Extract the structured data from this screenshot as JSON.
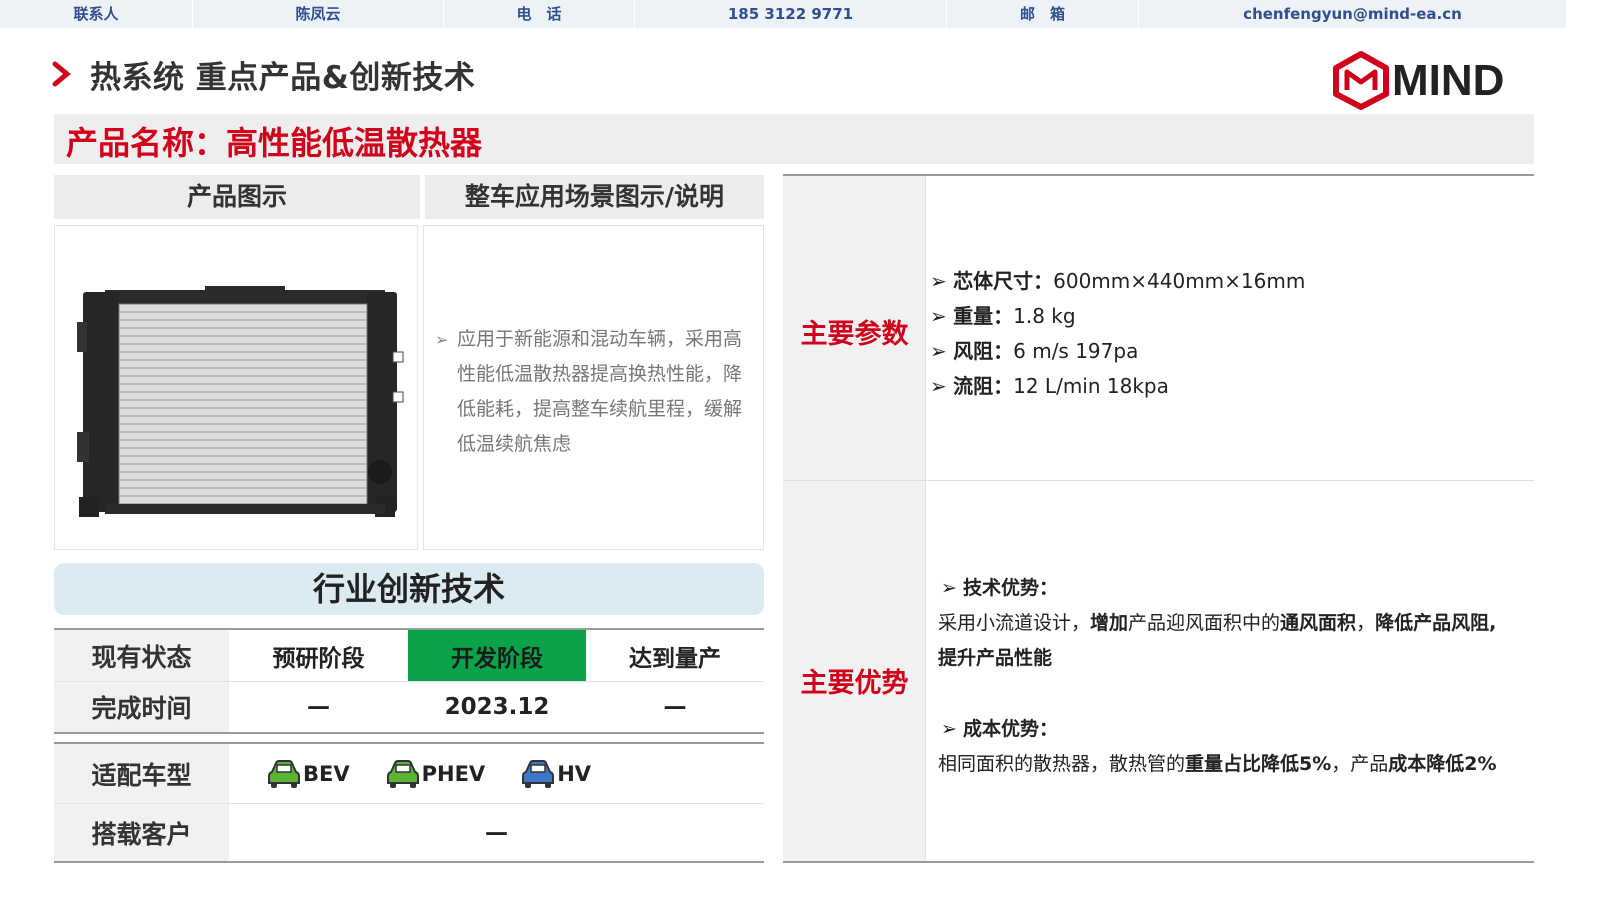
{
  "contact": {
    "label1": "联系人",
    "name": "陈凤云",
    "label2": "电　话",
    "phone": "185 3122 9771",
    "label3": "邮　箱",
    "email": "chenfengyun@mind-ea.cn"
  },
  "header": {
    "title": "热系统 重点产品&创新技术",
    "logo_text": "MIND"
  },
  "product": {
    "name": "产品名称：高性能低温散热器"
  },
  "sections": {
    "product_image": "产品图示",
    "scenario": "整车应用场景图示/说明"
  },
  "scenario_desc": "应用于新能源和混动车辆，采用高性能低温散热器提高换热性能，降低能耗，提高整车续航里程，缓解低温续航焦虑",
  "innovation": {
    "title": "行业创新技术",
    "status_label": "现有状态",
    "stages": [
      "预研阶段",
      "开发阶段",
      "达到量产"
    ],
    "time_label": "完成时间",
    "times": [
      "—",
      "2023.12",
      "—"
    ],
    "vehicle_label": "适配车型",
    "vehicles": [
      {
        "name": "BEV",
        "color": "#5bb336"
      },
      {
        "name": "PHEV",
        "color": "#5bb336"
      },
      {
        "name": "HV",
        "color": "#3d78c8"
      }
    ],
    "customer_label": "搭载客户",
    "customer": "—",
    "active_color": "#0aa34a"
  },
  "main_params": {
    "label": "主要参数",
    "items": [
      {
        "k": "芯体尺寸：",
        "v": "600mm×440mm×16mm"
      },
      {
        "k": "重量：",
        "v": "1.8 kg"
      },
      {
        "k": "风阻：",
        "v": "6 m/s 197pa"
      },
      {
        "k": "流阻：",
        "v": "12 L/min 18kpa"
      }
    ]
  },
  "main_adv": {
    "label": "主要优势",
    "tech_title": "技术优势：",
    "tech_p1": "采用小流道设计，",
    "tech_b1": "增加",
    "tech_p2": "产品迎风面积中的",
    "tech_b2": "通风面积",
    "tech_p3": "，",
    "tech_b3": "降低产品风阻,",
    "tech_b4": "提升产品性能",
    "cost_title": "成本优势：",
    "cost_p1": "相同面积的散热器，散热管的",
    "cost_b1": "重量占比降低5%",
    "cost_p2": "，产品",
    "cost_b2": "成本降低2%"
  },
  "colors": {
    "accent_red": "#d0021b",
    "header_blue": "#2f4f8f"
  }
}
